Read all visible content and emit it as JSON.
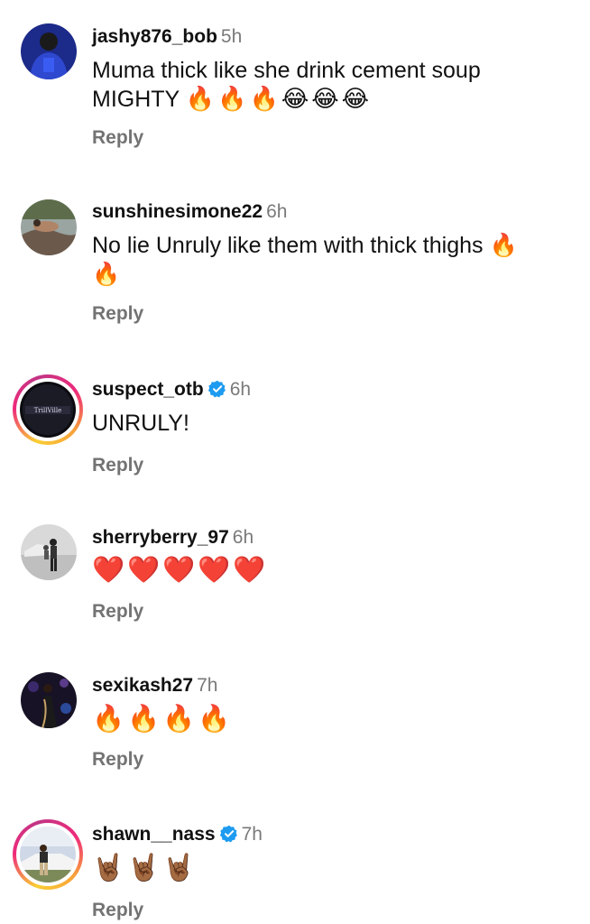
{
  "comments": [
    {
      "username": "jashy876_bob",
      "time": "5h",
      "verified": false,
      "text_line1": "Muma thick like she drink cement soup",
      "text_line2": "MIGHTY",
      "emoji": "🔥🔥🔥😂😂😂",
      "reply_label": "Reply"
    },
    {
      "username": "sunshinesimone22",
      "time": "6h",
      "verified": false,
      "text_line1": "No lie Unruly like them with thick thighs 🔥",
      "text_line2": "🔥",
      "reply_label": "Reply"
    },
    {
      "username": "suspect_otb",
      "time": "6h",
      "verified": true,
      "text_line1": "UNRULY!",
      "avatar_text": "TrillVille",
      "reply_label": "Reply"
    },
    {
      "username": "sherryberry_97",
      "time": "6h",
      "verified": false,
      "emoji": "❤️❤️❤️❤️❤️",
      "reply_label": "Reply"
    },
    {
      "username": "sexikash27",
      "time": "7h",
      "verified": false,
      "emoji": "🔥🔥🔥🔥",
      "reply_label": "Reply"
    },
    {
      "username": "shawn__nass",
      "time": "7h",
      "verified": true,
      "emoji": "🤘🏾🤘🏾🤘🏾",
      "reply_label": "Reply"
    }
  ],
  "colors": {
    "username": "#111111",
    "timestamp": "#7a7a7a",
    "reply": "#737373",
    "verified_badge": "#1d9bf0",
    "story_ring_start": "#f9ce34",
    "story_ring_end": "#ee2a7b"
  }
}
